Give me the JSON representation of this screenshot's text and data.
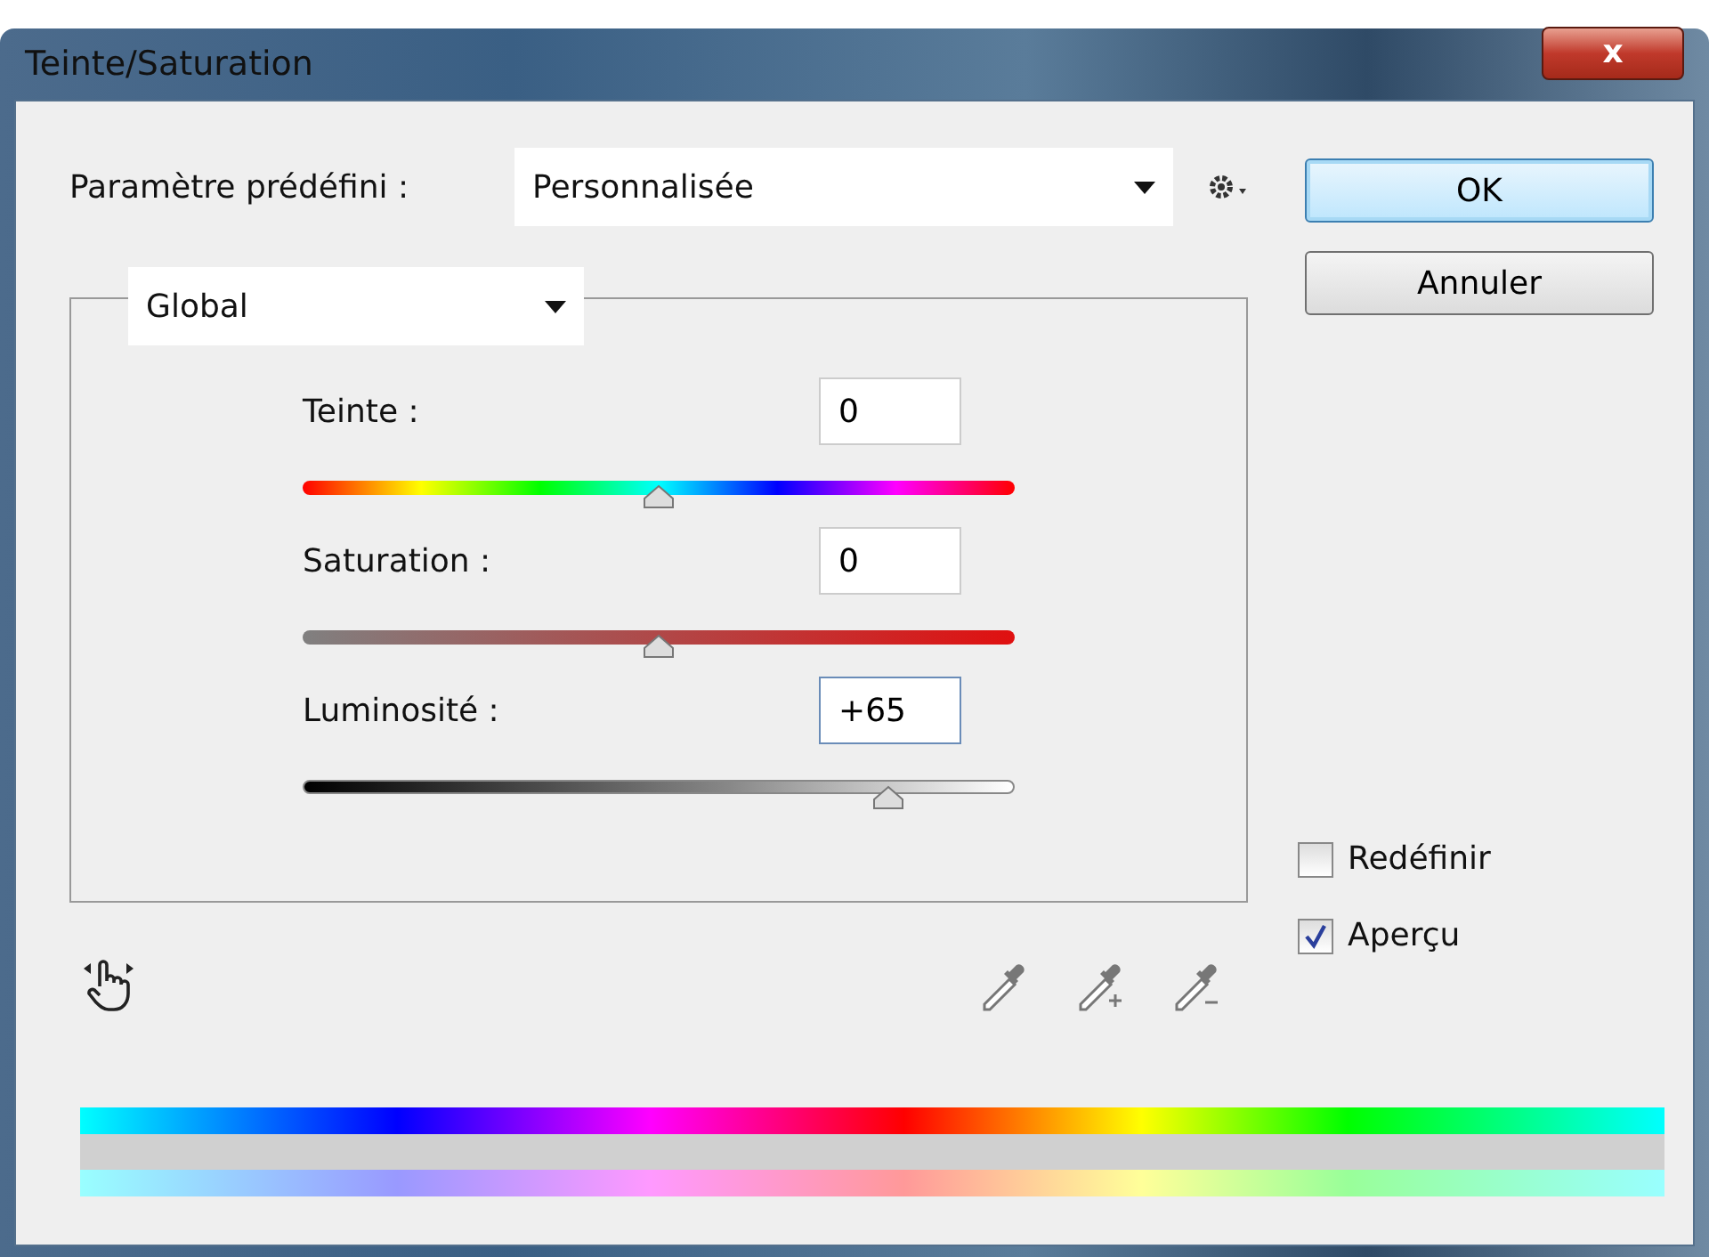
{
  "window": {
    "title": "Teinte/Saturation",
    "close_label": "x"
  },
  "preset": {
    "label": "Paramètre prédéfini :",
    "value": "Personnalisée"
  },
  "buttons": [
    {
      "label": "OK",
      "default": true
    },
    {
      "label": "Annuler",
      "default": false
    }
  ],
  "channel": {
    "value": "Global"
  },
  "sliders": [
    {
      "kind": "hue",
      "label": "Teinte :",
      "value": "0",
      "level": 0.5,
      "focused": false
    },
    {
      "kind": "saturation",
      "label": "Saturation :",
      "value": "0",
      "level": 0.5,
      "focused": false
    },
    {
      "kind": "lightness",
      "label": "Luminosité :",
      "value": "+65",
      "level": 0.825,
      "focused": true
    }
  ],
  "checkboxes": [
    {
      "label": "Redéfinir",
      "checked": false
    },
    {
      "label": "Aperçu",
      "checked": true
    }
  ]
}
